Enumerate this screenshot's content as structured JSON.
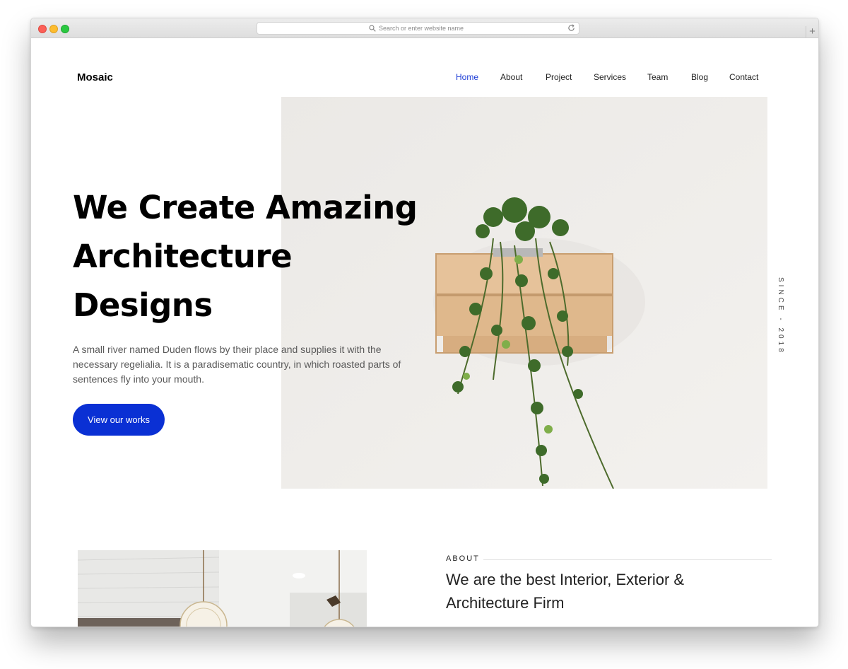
{
  "browser": {
    "url_placeholder": "Search or enter website name"
  },
  "site": {
    "logo": "Mosaic",
    "nav": [
      "Home",
      "About",
      "Project",
      "Services",
      "Team",
      "Blog",
      "Contact"
    ],
    "active_nav": "Home",
    "accent_color": "#0a30d4"
  },
  "hero": {
    "title_lines": [
      "We Create Amazing",
      "Architecture",
      "Designs"
    ],
    "description": "A small river named Duden flows by their place and supplies it with the necessary regelialia. It is a paradisematic country, in which roasted parts of sentences fly into your mouth.",
    "cta": "View our works",
    "since": "SINCE - 2018",
    "image": "plant-in-wooden-crate"
  },
  "about": {
    "label": "ABOUT",
    "heading": "We are the best Interior, Exterior & Architecture Firm",
    "image": "pendant-lights-interior"
  }
}
